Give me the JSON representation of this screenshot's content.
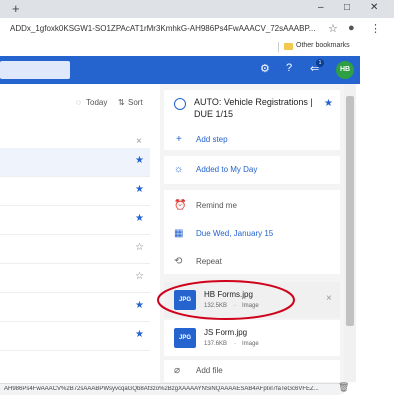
{
  "tabstrip": {
    "new_tab": "+",
    "minimize": "–",
    "maximize": "□",
    "close": "✕"
  },
  "address": {
    "url": "ADDx_1gfoxk0KSGW1-SO1ZPAcAT1rMr3KmhkG-AH986Ps4FwAAACV_72sAAABP...",
    "star": "☆",
    "profile": "●",
    "menu": "⋮"
  },
  "bookmarks": {
    "label": "Other bookmarks"
  },
  "appbar": {
    "settings": "⚙",
    "help": "?",
    "notify": "⇐",
    "badge": "1",
    "avatar": "HB"
  },
  "list": {
    "today_label": "Today",
    "sort_label": "Sort",
    "close": "×",
    "stars": [
      "★",
      "★",
      "★",
      "☆",
      "☆",
      "★",
      "★"
    ]
  },
  "detail": {
    "title": "AUTO: Vehicle Registrations | DUE 1/15",
    "add_step": "Add step",
    "my_day": "Added to My Day",
    "remind": "Remind me",
    "due": "Due Wed, January 15",
    "repeat": "Repeat",
    "files": [
      {
        "type": "JPG",
        "name": "HB Forms.jpg",
        "size": "132.5KB",
        "kind": "Image"
      },
      {
        "type": "JPG",
        "name": "JS Form.jpg",
        "size": "137.6KB",
        "kind": "Image"
      }
    ],
    "add_file": "Add file",
    "remove": "×",
    "separator": "·"
  },
  "status": {
    "text": "AH986Ps4FwAAACV%2B72sAAABPWsyvcqaGQb8Af3zo%2BzgXAAAAYNSiNQAAAAESAB4AFpIxl7faTeGc6VFEZ..."
  },
  "colors": {
    "accent": "#2564cf",
    "avatar": "#2ea043",
    "highlight_circle": "#d0021b"
  }
}
